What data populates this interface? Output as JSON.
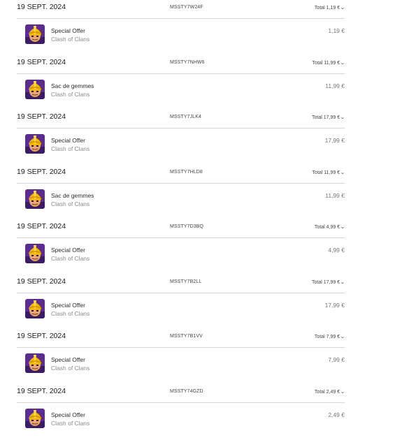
{
  "orders": [
    {
      "date": "19 SEPT. 2024",
      "id": "MSSTY7W24F",
      "total": "Total 1,19 €",
      "item": {
        "name": "Special Offer",
        "publisher": "Clash of Clans",
        "price": "1,19 €",
        "icon": "clash-of-clans-app-icon"
      }
    },
    {
      "date": "19 SEPT. 2024",
      "id": "MSSTY7NHW6",
      "total": "Total 11,99 €",
      "item": {
        "name": "Sac de gemmes",
        "publisher": "Clash of Clans",
        "price": "11,99 €",
        "icon": "clash-of-clans-app-icon"
      }
    },
    {
      "date": "19 SEPT. 2024",
      "id": "MSSTY7JLK4",
      "total": "Total 17,99 €",
      "item": {
        "name": "Special Offer",
        "publisher": "Clash of Clans",
        "price": "17,99 €",
        "icon": "clash-of-clans-app-icon"
      }
    },
    {
      "date": "19 SEPT. 2024",
      "id": "MSSTY7HLD8",
      "total": "Total 11,99 €",
      "item": {
        "name": "Sac de gemmes",
        "publisher": "Clash of Clans",
        "price": "11,99 €",
        "icon": "clash-of-clans-app-icon"
      }
    },
    {
      "date": "19 SEPT. 2024",
      "id": "MSSTY7D3BQ",
      "total": "Total 4,99 €",
      "item": {
        "name": "Special Offer",
        "publisher": "Clash of Clans",
        "price": "4,99 €",
        "icon": "clash-of-clans-app-icon"
      }
    },
    {
      "date": "19 SEPT. 2024",
      "id": "MSSTY7B2LL",
      "total": "Total 17,99 €",
      "item": {
        "name": "Special Offer",
        "publisher": "Clash of Clans",
        "price": "17,99 €",
        "icon": "clash-of-clans-app-icon"
      }
    },
    {
      "date": "19 SEPT. 2024",
      "id": "MSSTY7B1VV",
      "total": "Total 7,99 €",
      "item": {
        "name": "Special Offer",
        "publisher": "Clash of Clans",
        "price": "7,99 €",
        "icon": "clash-of-clans-app-icon"
      }
    },
    {
      "date": "19 SEPT. 2024",
      "id": "MSSTY74GZD",
      "total": "Total 2,49 €",
      "item": {
        "name": "Special Offer",
        "publisher": "Clash of Clans",
        "price": "2,49 €",
        "icon": "clash-of-clans-app-icon"
      }
    }
  ],
  "total_toggle_icon": "chevron-down-icon",
  "colors": {
    "divider": "#d6d6d6",
    "secondary_text": "#8a8a8a",
    "icon_background": "#5b2d8f",
    "icon_helmet": "#f2b705"
  }
}
